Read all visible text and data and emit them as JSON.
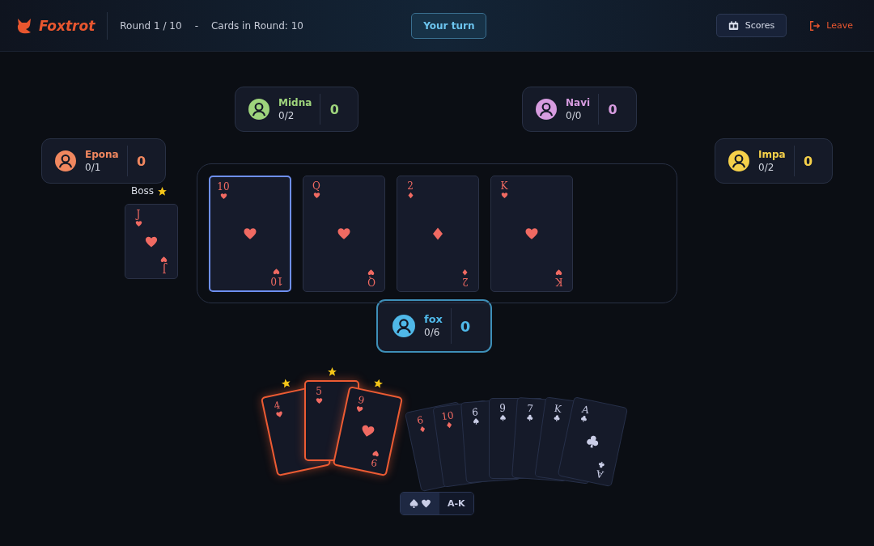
{
  "header": {
    "brand": "Foxtrot",
    "round": "Round 1 / 10",
    "separator": "-",
    "cards_in_round": "Cards in Round: 10",
    "turn": "Your turn",
    "scores": "Scores",
    "leave": "Leave"
  },
  "players": [
    {
      "name": "Midna",
      "tricks": "0/2",
      "score": "0",
      "color": "#9ed47c",
      "active": false
    },
    {
      "name": "Navi",
      "tricks": "0/0",
      "score": "0",
      "color": "#d79ce0",
      "active": false
    },
    {
      "name": "Epona",
      "tricks": "0/1",
      "score": "0",
      "color": "#f0875f",
      "active": false
    },
    {
      "name": "Impa",
      "tricks": "0/2",
      "score": "0",
      "color": "#f5d04a",
      "active": false
    },
    {
      "name": "fox",
      "tricks": "0/6",
      "score": "0",
      "color": "#4fb8e8",
      "active": true
    }
  ],
  "boss": {
    "label": "Boss",
    "card": {
      "kind": "hearts",
      "ranks": [
        "J",
        "J"
      ]
    }
  },
  "trick": [
    {
      "kind": "hearts",
      "ranks": [
        "10",
        "10"
      ],
      "selected": true
    },
    {
      "kind": "hearts",
      "ranks": [
        "Q",
        "Q"
      ],
      "selected": false
    },
    {
      "kind": "diamonds",
      "ranks": [
        "2",
        "2"
      ],
      "selected": false
    },
    {
      "kind": "hearts",
      "ranks": [
        "K",
        "K"
      ],
      "selected": false
    }
  ],
  "hand": [
    {
      "kind": "hearts",
      "ranks": [
        "4"
      ],
      "playable": true
    },
    {
      "kind": "hearts",
      "ranks": [
        "5"
      ],
      "playable": true
    },
    {
      "kind": "hearts",
      "ranks": [
        "9",
        "9"
      ],
      "playable": true
    },
    {
      "kind": "diamonds",
      "ranks": [
        "6"
      ],
      "playable": false
    },
    {
      "kind": "diamonds",
      "ranks": [
        "10"
      ],
      "playable": false
    },
    {
      "kind": "spades",
      "ranks": [
        "6"
      ],
      "playable": false
    },
    {
      "kind": "spades",
      "ranks": [
        "9"
      ],
      "playable": false
    },
    {
      "kind": "clubs",
      "ranks": [
        "7"
      ],
      "playable": false
    },
    {
      "kind": "clubs",
      "ranks": [
        "K"
      ],
      "playable": false
    },
    {
      "kind": "clubs",
      "ranks": [
        "A",
        "A"
      ],
      "playable": false
    }
  ],
  "sort": [
    {
      "icons": [
        {
          "kind": "spades"
        },
        {
          "kind": "hearts"
        }
      ],
      "selected": true
    },
    {
      "label": "A-K",
      "selected": false
    }
  ]
}
